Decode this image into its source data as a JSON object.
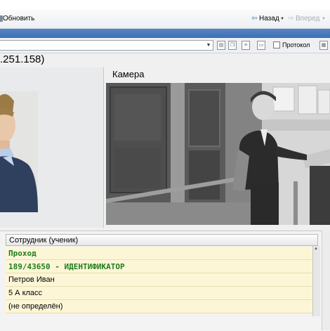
{
  "toolbar": {
    "refresh_label": "Обновить",
    "back_label": "Назад",
    "forward_label": "Вперед"
  },
  "controls": {
    "protocol_label": "Протокол"
  },
  "header": {
    "ip_text": ".251.158)"
  },
  "camera": {
    "title": "Камера"
  },
  "table": {
    "column_header": "Сотрудник (ученик)",
    "rows": [
      "Проход",
      "189/43650 - ИДЕНТИФИКАТОР",
      "Петров Иван",
      "5 А класс",
      "(не определён)"
    ]
  },
  "colors": {
    "accent_blue": "#4a79bb",
    "highlight_row": "#fdf6d6",
    "event_green": "#1e7d1e"
  }
}
